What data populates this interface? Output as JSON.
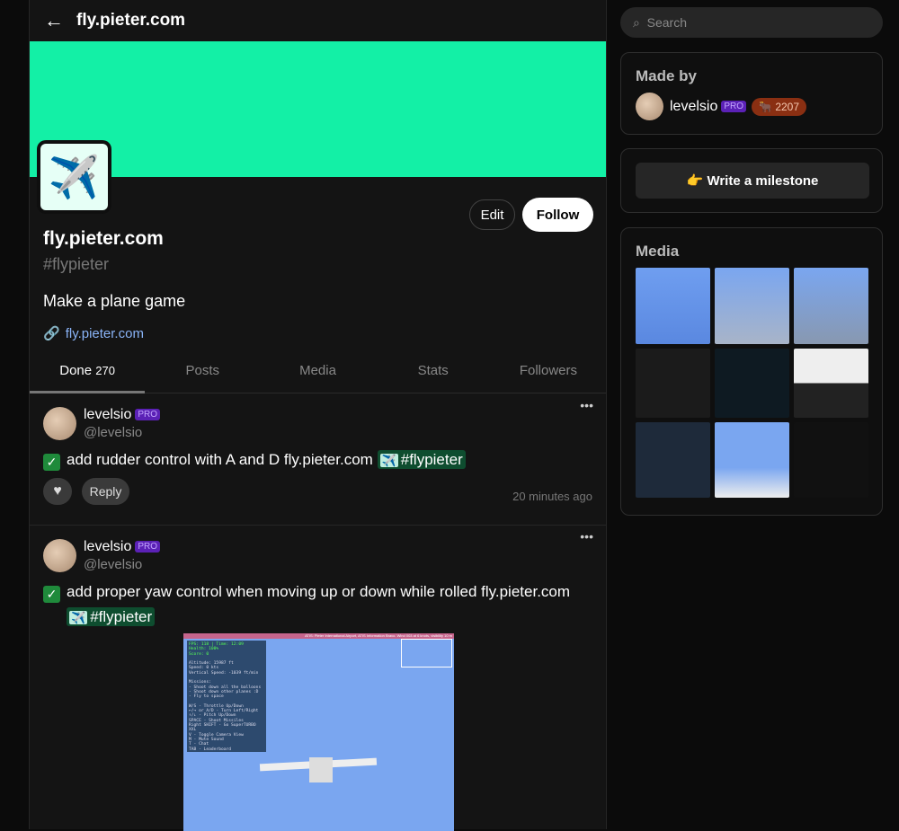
{
  "header": {
    "title": "fly.pieter.com",
    "back_icon": "arrow-left-icon"
  },
  "colors": {
    "banner": "#13f0a6",
    "pro": "#5b21b6",
    "hashtag_bg": "#0e4d2f",
    "karma_bg": "#8a2f12"
  },
  "profile": {
    "logo_emoji": "✈️",
    "name": "fly.pieter.com",
    "hashtag": "#flypieter",
    "description": "Make a plane game",
    "link": "fly.pieter.com",
    "edit_label": "Edit",
    "follow_label": "Follow"
  },
  "tabs": [
    {
      "label": "Done",
      "count": "270"
    },
    {
      "label": "Posts"
    },
    {
      "label": "Media"
    },
    {
      "label": "Stats"
    },
    {
      "label": "Followers"
    }
  ],
  "posts": [
    {
      "user": "levelsio",
      "badge": "PRO",
      "handle": "@levelsio",
      "text": "add rudder control with A and D fly.pieter.com",
      "tag_emoji": "✈️",
      "tag": "#flypieter",
      "reply_label": "Reply",
      "time": "20 minutes ago"
    },
    {
      "user": "levelsio",
      "badge": "PRO",
      "handle": "@levelsio",
      "text": "add proper yaw control when moving up or down while rolled fly.pieter.com",
      "tag_emoji": "✈️",
      "tag": "#flypieter",
      "screenshot": {
        "atis": "ATIS: Pieter International Airport, ATIS Information Bravo. Wind 003 at 6 knots, visibility 10 m",
        "hud": [
          "FPS: 118 | Time: 12:09",
          "Health: 100%",
          "Score: 0",
          "",
          "Altitude: 15987 ft",
          "Speed: 0 kts",
          "Vertical Speed: -1039 ft/min",
          "",
          "Missions:",
          "- Shoot down all the balloons",
          "- Shoot down other planes :D",
          "- Fly to space",
          "",
          "W/S - Throttle Up/Down",
          "←/→ or A/D - Turn Left/Right",
          "↑/↓ - Pitch Up/Down",
          "SPACE - Shoot Missiles",
          "Right SHIFT - Go SuperTURBO XXL",
          "V - Toggle Camera View",
          "M - Mute Sound",
          "T - Chat",
          "TAB - Leaderboard"
        ]
      }
    }
  ],
  "sidebar": {
    "search_placeholder": "Search",
    "made_by": {
      "title": "Made by",
      "user": "levelsio",
      "badge": "PRO",
      "karma": "2207",
      "karma_emoji": "🐂"
    },
    "milestone_label": "👉 Write a milestone",
    "media": {
      "title": "Media",
      "thumbs": 9
    }
  }
}
